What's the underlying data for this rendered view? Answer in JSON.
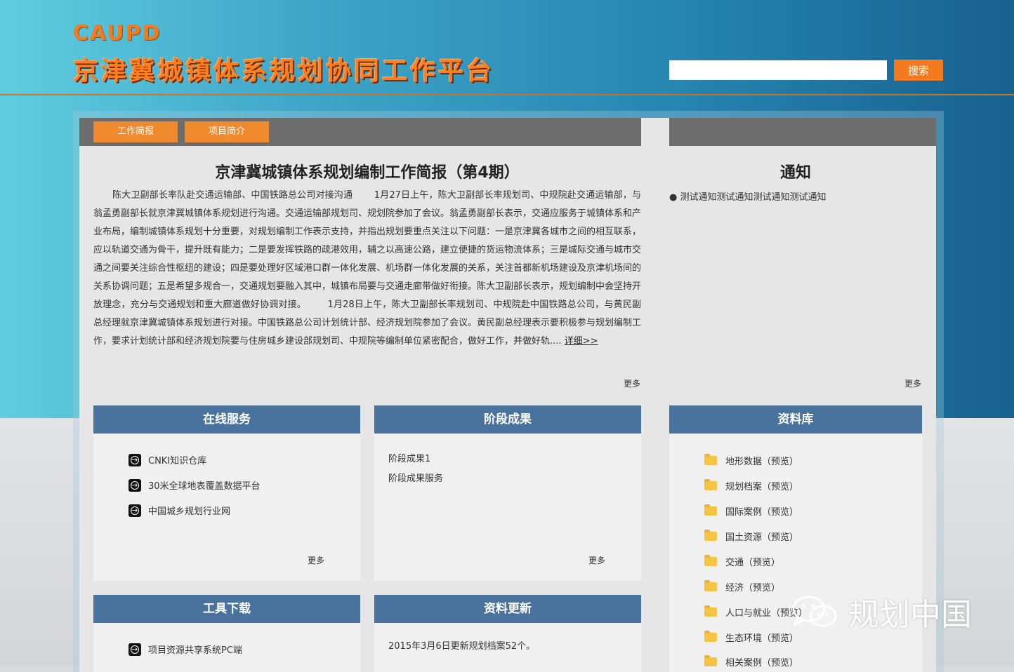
{
  "header": {
    "logo": "CAUPD",
    "title": "京津冀城镇体系规划协同工作平台",
    "search_placeholder": "",
    "search_button": "搜索"
  },
  "tabs": [
    "工作简报",
    "项目简介"
  ],
  "brief": {
    "title": "京津冀城镇体系规划编制工作简报（第4期）",
    "body": "陈大卫副部长率队赴交通运输部、中国铁路总公司对接沟通 　　1月27日上午，陈大卫副部长率规划司、中规院赴交通运输部，与翁孟勇副部长就京津冀城镇体系规划进行沟通。交通运输部规划司、规划院参加了会议。翁孟勇副部长表示，交通应服务于城镇体系和产业布局，编制城镇体系规划十分重要，对规划编制工作表示支持，并指出规划要重点关注以下问题：一是京津冀各城市之间的相互联系，应以轨道交通为骨干，提升既有能力；二是要发挥铁路的疏港效用，辅之以高速公路，建立便捷的货运物流体系；三是城际交通与城市交通之间要关注综合性枢纽的建设；四是要处理好区域港口群一体化发展、机场群一体化发展的关系，关注首都新机场建设及京津机场间的关系协调问题；五是希望多规合一，交通规划要融入其中，城镇布局要与交通走廊带做好衔接。陈大卫副部长表示，规划编制中会坚持开放理念，充分与交通规划和重大廊道做好协调对接。 　　1月28日上午，陈大卫副部长率规划司、中规院赴中国铁路总公司，与黄民副总经理就京津冀城镇体系规划进行对接。中国铁路总公司计划统计部、经济规划院参加了会议。黄民副总经理表示要积极参与规划编制工作，要求计划统计部和经济规划院要与住房城乡建设部规划司、中规院等编制单位紧密配合，做好工作，并做好轨....",
    "detail_link": "详细>>",
    "more": "更多"
  },
  "notice": {
    "title": "通知",
    "items": [
      "测试通知测试通知测试通知测试通知"
    ],
    "more": "更多"
  },
  "online_service": {
    "title": "在线服务",
    "links": [
      "CNKI知识仓库",
      "30米全球地表覆盖数据平台",
      "中国城乡规划行业网"
    ],
    "more": "更多"
  },
  "stage_results": {
    "title": "阶段成果",
    "items": [
      "阶段成果1",
      "阶段成果服务"
    ],
    "more": "更多"
  },
  "library": {
    "title": "资料库",
    "items": [
      "地形数据（预览）",
      "规划档案（预览）",
      "国际案例（预览）",
      "国土资源（预览）",
      "交通（预览）",
      "经济（预览）",
      "人口与就业（预览）",
      "生态环境（预览）",
      "相关案例（预览）"
    ]
  },
  "tools": {
    "title": "工具下载",
    "links": [
      "项目资源共享系统PC端"
    ]
  },
  "updates": {
    "title": "资料更新",
    "items": [
      "2015年3月6日更新规划档案52个。"
    ]
  },
  "watermark": "规划中国"
}
